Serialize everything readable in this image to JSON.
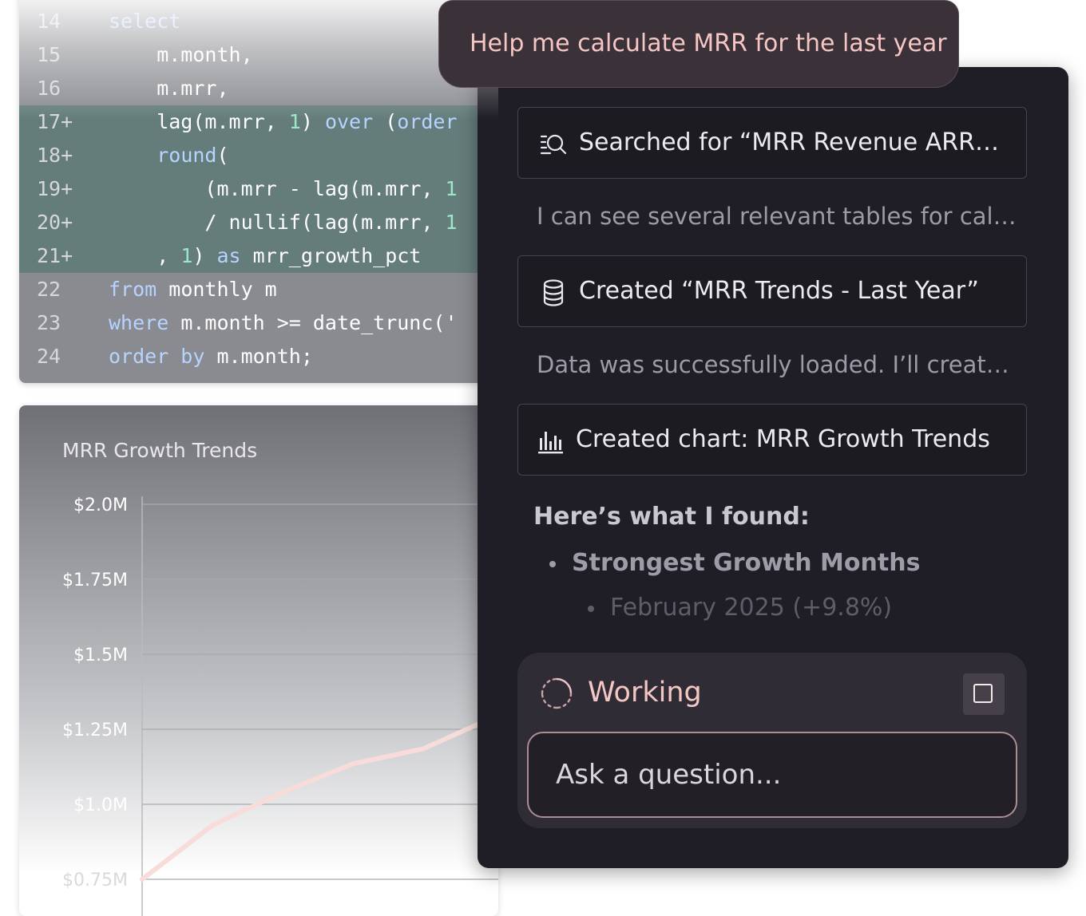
{
  "code": {
    "lines": [
      {
        "num": "14",
        "added": false,
        "parts": [
          [
            "kw",
            "select"
          ]
        ]
      },
      {
        "num": "15",
        "added": false,
        "parts": [
          [
            "t",
            "    m.month,"
          ]
        ]
      },
      {
        "num": "16",
        "added": false,
        "parts": [
          [
            "t",
            "    m.mrr,"
          ]
        ]
      },
      {
        "num": "17+",
        "added": true,
        "parts": [
          [
            "t",
            "    lag(m.mrr, "
          ],
          [
            "num",
            "1"
          ],
          [
            "t",
            ") "
          ],
          [
            "kw",
            "over"
          ],
          [
            "t",
            " ("
          ],
          [
            "kw",
            "order"
          ]
        ]
      },
      {
        "num": "18+",
        "added": true,
        "parts": [
          [
            "t",
            "    "
          ],
          [
            "kw",
            "round"
          ],
          [
            "t",
            "("
          ]
        ]
      },
      {
        "num": "19+",
        "added": true,
        "parts": [
          [
            "t",
            "        (m.mrr - lag(m.mrr, "
          ],
          [
            "num",
            "1"
          ]
        ]
      },
      {
        "num": "20+",
        "added": true,
        "parts": [
          [
            "t",
            "        / nullif(lag(m.mrr, "
          ],
          [
            "num",
            "1"
          ]
        ]
      },
      {
        "num": "21+",
        "added": true,
        "parts": [
          [
            "t",
            "    , "
          ],
          [
            "num",
            "1"
          ],
          [
            "t",
            ") "
          ],
          [
            "kw",
            "as"
          ],
          [
            "t",
            " mrr_growth_pct"
          ]
        ]
      },
      {
        "num": "22",
        "added": false,
        "parts": [
          [
            "kw",
            "from"
          ],
          [
            "t",
            " monthly m"
          ]
        ]
      },
      {
        "num": "23",
        "added": false,
        "parts": [
          [
            "kw",
            "where"
          ],
          [
            "t",
            " m.month >= date_trunc('"
          ]
        ]
      },
      {
        "num": "24",
        "added": false,
        "parts": [
          [
            "kw",
            "order by"
          ],
          [
            "t",
            " m.month;"
          ]
        ]
      }
    ]
  },
  "chart_data": {
    "type": "line",
    "title": "MRR Growth Trends",
    "y_ticks": [
      "$2.0M",
      "$1.75M",
      "$1.5M",
      "$1.25M",
      "$1.0M",
      "$0.75M"
    ],
    "ylim": [
      750000,
      2000000
    ],
    "grid": true,
    "series": [
      {
        "color": "#f7dcd9",
        "points": [
          [
            0,
            750000
          ],
          [
            1,
            930000
          ],
          [
            2,
            1040000
          ],
          [
            3,
            1135000
          ],
          [
            4,
            1185000
          ],
          [
            5,
            1290000
          ],
          [
            5.2,
            1395000
          ]
        ]
      }
    ]
  },
  "chat": {
    "user_message": "Help me calculate MRR for the last year",
    "steps": [
      {
        "icon": "search-icon",
        "label": "Searched for “MRR Revenue ARR…"
      },
      {
        "icon": "database-icon",
        "label": "Created “MRR Trends - Last Year”"
      },
      {
        "icon": "bar-chart-icon",
        "label": "Created chart: MRR Growth Trends"
      }
    ],
    "replies": [
      "I can see several relevant tables for cal…",
      "Data was successfully loaded. I’ll creat…"
    ],
    "found_heading": "Here’s what I found:",
    "bullet_main": "Strongest Growth Months",
    "bullet_sub": "February 2025 (+9.8%)",
    "status": "Working",
    "input_placeholder": "Ask a question..."
  },
  "colors": {
    "accent_pink": "#f4c6c4",
    "panel_bg": "#1f1e26"
  }
}
